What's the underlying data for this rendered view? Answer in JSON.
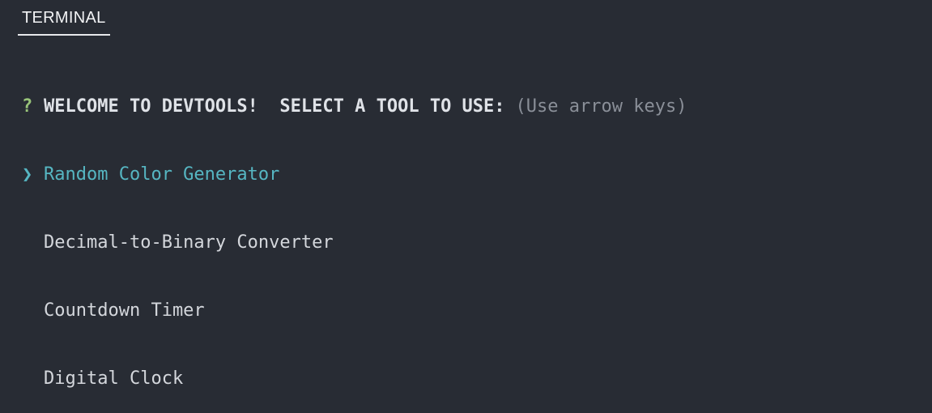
{
  "panel": {
    "tab_label": "TERMINAL"
  },
  "prompt": {
    "question_mark": "?",
    "message": "WELCOME TO DEVTOOLS!  SELECT A TOOL TO USE:",
    "hint": "(Use arrow keys)"
  },
  "menu": {
    "pointer": "❯",
    "selected_index": 0,
    "options": [
      "Random Color Generator",
      "Decimal-to-Binary Converter",
      "Countdown Timer",
      "Digital Clock"
    ]
  },
  "colors": {
    "background": "#282c34",
    "question_mark": "#98c379",
    "selected": "#56b6c2",
    "hint": "#8a8f98",
    "text": "#d4d7dc"
  }
}
